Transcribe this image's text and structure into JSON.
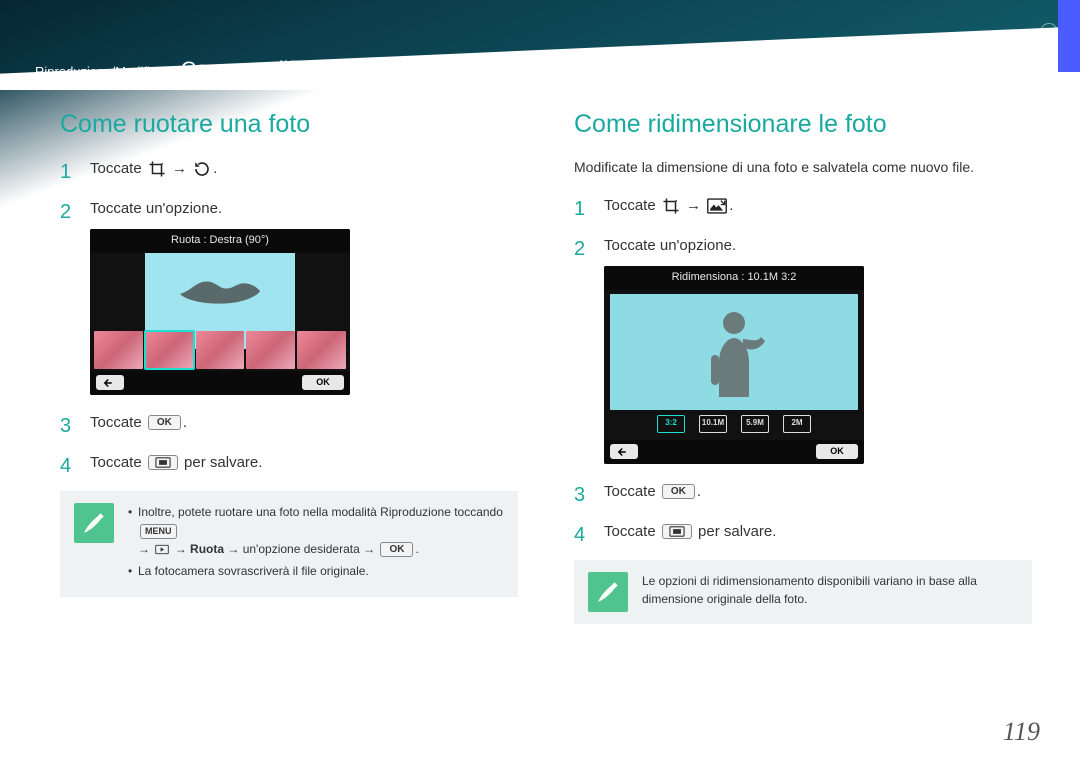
{
  "header": {
    "breadcrumb_prefix": "Riproduzione/Modifica >",
    "breadcrumb_title": "Come modificare le foto"
  },
  "left": {
    "heading": "Come ruotare una foto",
    "steps": {
      "s1_a": "Toccate",
      "s1_b": "→",
      "s2": "Toccate un'opzione.",
      "s3_a": "Toccate",
      "s4_a": "Toccate",
      "s4_b": "per salvare."
    },
    "screenshot": {
      "title": "Ruota : Destra (90°)",
      "ok": "OK"
    },
    "note": {
      "line1_a": "Inoltre, potete ruotare una foto nella modalità Riproduzione toccando",
      "line2_a": "→",
      "line2_b": "→",
      "line2_ruota": "Ruota",
      "line2_c": "→ un'opzione desiderata →",
      "line3": "La fotocamera sovrascriverà il file originale."
    }
  },
  "right": {
    "heading": "Come ridimensionare le foto",
    "intro": "Modificate la dimensione di una foto e salvatela come nuovo file.",
    "steps": {
      "s1_a": "Toccate",
      "s1_b": "→",
      "s2": "Toccate un'opzione.",
      "s3_a": "Toccate",
      "s4_a": "Toccate",
      "s4_b": "per salvare."
    },
    "screenshot": {
      "title": "Ridimensiona : 10.1M 3:2",
      "ok": "OK",
      "chips": [
        "3:2",
        "10.1M",
        "5.9M",
        "2M"
      ]
    },
    "note": "Le opzioni di ridimensionamento disponibili variano in base alla dimensione originale della foto."
  },
  "labels": {
    "ok": "OK",
    "menu": "MENU"
  },
  "page_number": "119"
}
